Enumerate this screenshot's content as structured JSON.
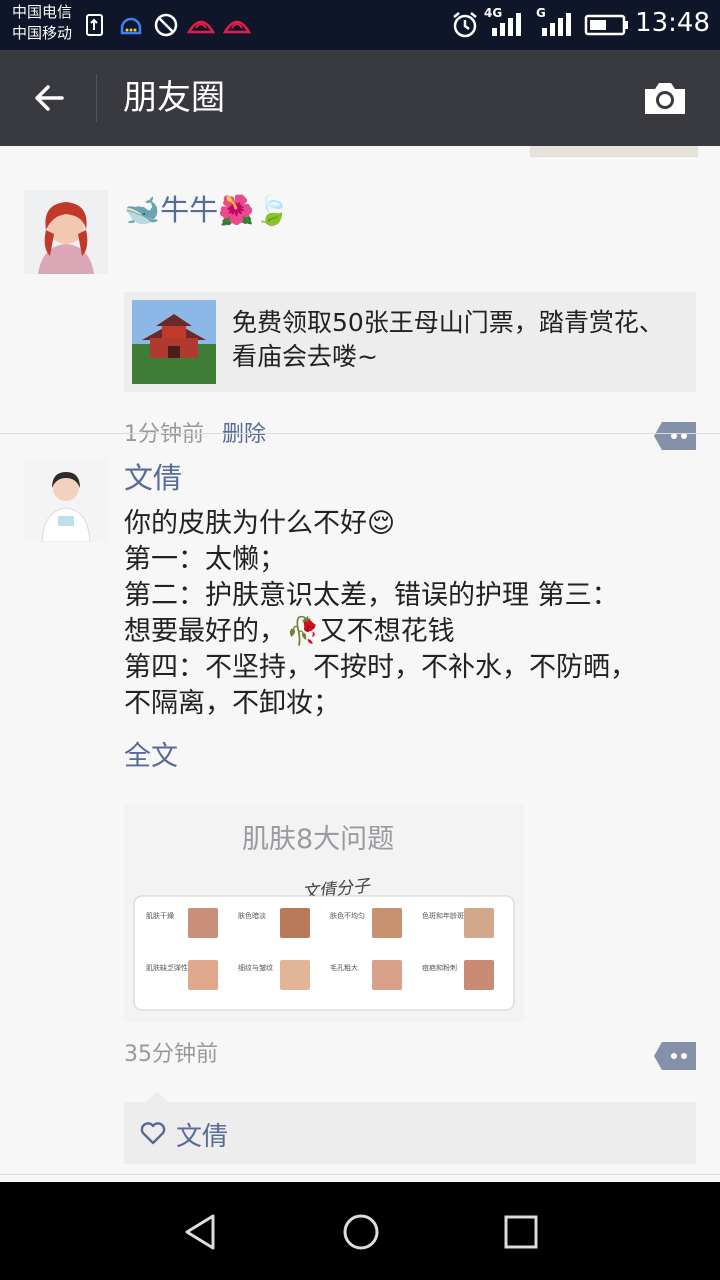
{
  "status_bar": {
    "carrier_1": "中国电信",
    "carrier_2": "中国移动",
    "network_1": "4G",
    "network_2": "G",
    "time": "13:48"
  },
  "app_bar": {
    "title": "朋友圈",
    "back_icon": "back-arrow-icon",
    "camera_icon": "camera-icon"
  },
  "posts": [
    {
      "author": "🐋牛牛🌺🍃",
      "link_card": {
        "text": "免费领取50张王母山门票，踏青赏花、看庙会去喽~"
      },
      "time": "1分钟前",
      "delete_label": "删除"
    },
    {
      "author": "文倩",
      "text_lines": [
        "你的皮肤为什么不好😌",
        "第一：太懒；",
        "第二：护肤意识太差，错误的护理 第三：",
        "想要最好的，🥀又不想花钱",
        "第四：不坚持，不按时，不补水，不防晒，",
        "不隔离，不卸妆；"
      ],
      "full_text_label": "全文",
      "image": {
        "heading": "肌肤8大问题",
        "watermark": "文倩分子",
        "tiles": [
          "肌肤干燥",
          "肤色暗淡",
          "肤色不均匀",
          "色斑和年龄斑",
          "肌肤缺乏弹性",
          "细纹与皱纹",
          "毛孔粗大",
          "痘疤和粉刺"
        ]
      },
      "time": "35分钟前",
      "likes": [
        "文倩"
      ]
    }
  ],
  "colors": {
    "status_bar": "#10162a",
    "app_bar": "#393a3f",
    "link_blue": "#576b95",
    "feed_bg": "#f7f7f7"
  }
}
